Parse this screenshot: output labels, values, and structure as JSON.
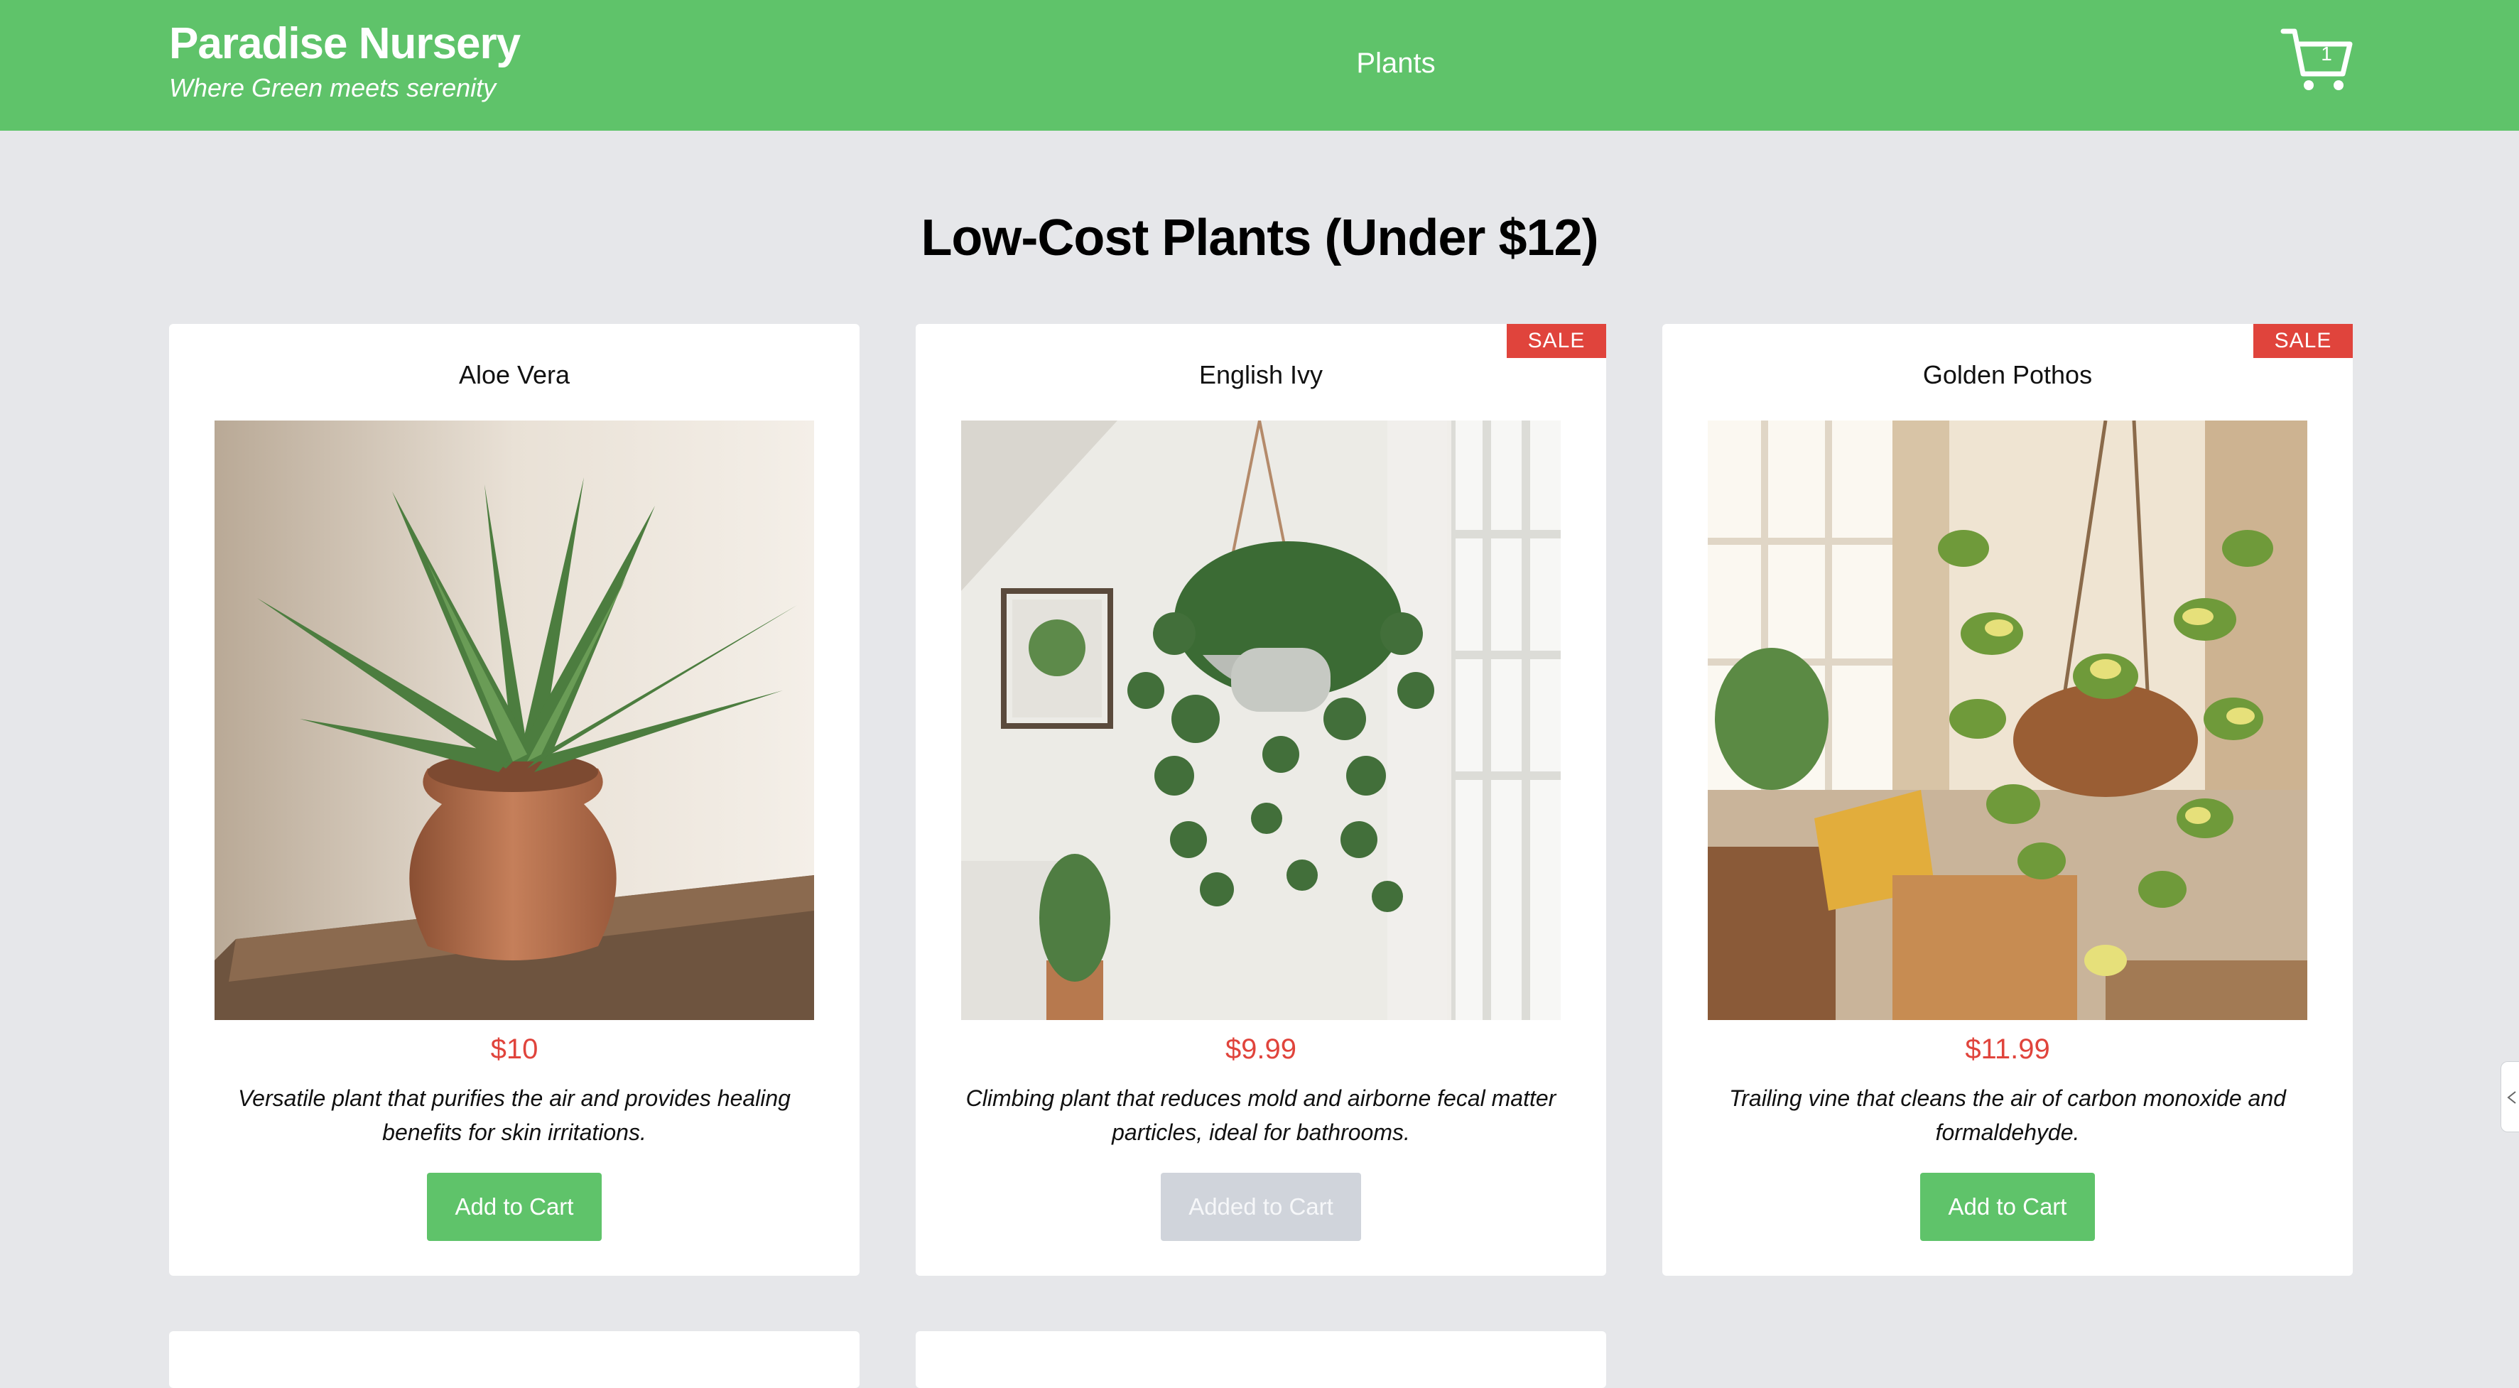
{
  "header": {
    "brand_title": "Paradise Nursery",
    "brand_tagline": "Where Green meets serenity",
    "nav_link": "Plants",
    "cart_count": "1"
  },
  "section_title": "Low-Cost Plants (Under $12)",
  "products": [
    {
      "name": "Aloe Vera",
      "price": "$10",
      "description": "Versatile plant that purifies the air and provides healing benefits for skin irritations.",
      "button_label": "Add to Cart",
      "button_state": "enabled",
      "badge": ""
    },
    {
      "name": "English Ivy",
      "price": "$9.99",
      "description": "Climbing plant that reduces mold and airborne fecal matter particles, ideal for bathrooms.",
      "button_label": "Added to Cart",
      "button_state": "disabled",
      "badge": "SALE"
    },
    {
      "name": "Golden Pothos",
      "price": "$11.99",
      "description": "Trailing vine that cleans the air of carbon monoxide and formaldehyde.",
      "button_label": "Add to Cart",
      "button_state": "enabled",
      "badge": "SALE"
    }
  ],
  "colors": {
    "header_green": "#5fc36a",
    "price_red": "#e0443c",
    "sale_red": "#e0443c",
    "page_bg": "#e6e7ea",
    "disabled_button": "#d0d4db"
  },
  "icons": {
    "cart": "shopping-cart-icon",
    "edge_tab": "chevron-icon"
  }
}
